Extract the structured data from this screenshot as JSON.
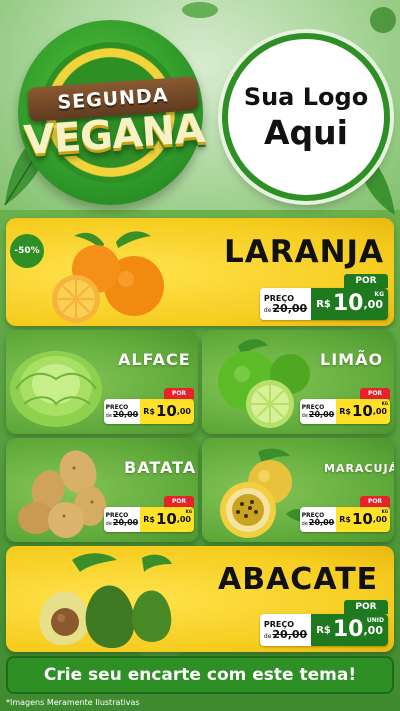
{
  "header": {
    "badge_line1": "SEGUNDA",
    "badge_line2": "VEGANA",
    "logo_line1": "Sua Logo",
    "logo_line2": "Aqui"
  },
  "products": {
    "laranja": {
      "name": "LARANJA",
      "discount": "-50%",
      "por": "POR",
      "preco_label": "PREÇO",
      "de": "de",
      "old_price": "20,00",
      "currency": "R$",
      "price_int": "10",
      "price_dec": ",00",
      "unit": "KG"
    },
    "alface": {
      "name": "ALFACE",
      "por": "POR",
      "preco_label": "PREÇO",
      "de": "de",
      "old_price": "20,00",
      "currency": "R$",
      "price_int": "10",
      "price_dec": ",00",
      "unit": ""
    },
    "limao": {
      "name": "LIMÃO",
      "por": "POR",
      "preco_label": "PREÇO",
      "de": "de",
      "old_price": "20,00",
      "currency": "R$",
      "price_int": "10",
      "price_dec": ",00",
      "unit": "KG"
    },
    "batata": {
      "name": "BATATA",
      "por": "POR",
      "preco_label": "PREÇO",
      "de": "de",
      "old_price": "20,00",
      "currency": "R$",
      "price_int": "10",
      "price_dec": ",00",
      "unit": "KG"
    },
    "maracuja": {
      "name": "MARACUJÁ",
      "por": "POR",
      "preco_label": "PREÇO",
      "de": "de",
      "old_price": "20,00",
      "currency": "R$",
      "price_int": "10",
      "price_dec": ",00",
      "unit": "KG"
    },
    "abacate": {
      "name": "ABACATE",
      "por": "POR",
      "preco_label": "PREÇO",
      "de": "de",
      "old_price": "20,00",
      "currency": "R$",
      "price_int": "10",
      "price_dec": ",00",
      "unit": "UNID"
    }
  },
  "footer": {
    "cta": "Crie seu encarte com este tema!",
    "disclaimer": "*Imagens Meramente Ilustrativas"
  },
  "colors": {
    "brand_green": "#2e8f25",
    "card_yellow": "#f6cc1f",
    "card_green": "#5ea83a",
    "price_red": "#e8212b"
  },
  "icons": [
    "orange-icon",
    "lettuce-icon",
    "lime-icon",
    "potato-icon",
    "passion-fruit-icon",
    "avocado-icon",
    "leaf-icon"
  ]
}
